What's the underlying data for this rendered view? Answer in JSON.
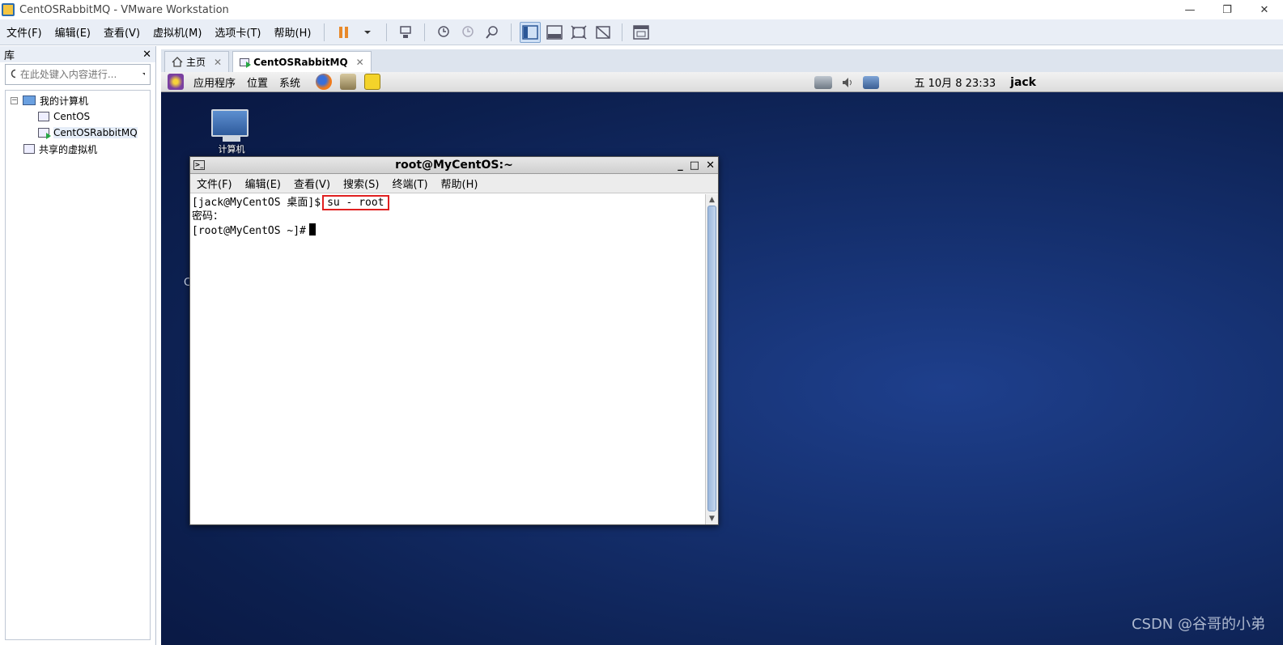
{
  "window": {
    "title": "CentOSRabbitMQ - VMware Workstation",
    "minimize": "—",
    "restore": "❐",
    "close": "✕"
  },
  "menubar": {
    "items": [
      "文件(F)",
      "编辑(E)",
      "查看(V)",
      "虚拟机(M)",
      "选项卡(T)",
      "帮助(H)"
    ]
  },
  "library": {
    "title": "库",
    "close": "✕",
    "search_placeholder": "在此处键入内容进行...",
    "tree": {
      "root": "我的计算机",
      "toggle": "−",
      "vms": [
        "CentOS",
        "CentOSRabbitMQ"
      ],
      "shared": "共享的虚拟机"
    }
  },
  "tabs": [
    {
      "label": "主页",
      "close": "✕"
    },
    {
      "label": "CentOSRabbitMQ",
      "close": "✕"
    }
  ],
  "guest": {
    "panel": {
      "menus": [
        "应用程序",
        "位置",
        "系统"
      ],
      "clock": "五 10月  8 23:33",
      "user": "jack"
    },
    "desktop_icon_label": "计算机",
    "desktop_ghost_text": "C"
  },
  "terminal": {
    "title": "root@MyCentOS:~",
    "menu": [
      "文件(F)",
      "编辑(E)",
      "查看(V)",
      "搜索(S)",
      "终端(T)",
      "帮助(H)"
    ],
    "line1_prompt": "[jack@MyCentOS 桌面]$",
    "line1_cmd": "su - root",
    "line2": "密码：",
    "line3_prompt": "[root@MyCentOS ~]#"
  },
  "watermark": "CSDN @谷哥的小弟",
  "colors": {
    "highlight_box": "#e02020",
    "pause_icon": "#e8892a"
  }
}
